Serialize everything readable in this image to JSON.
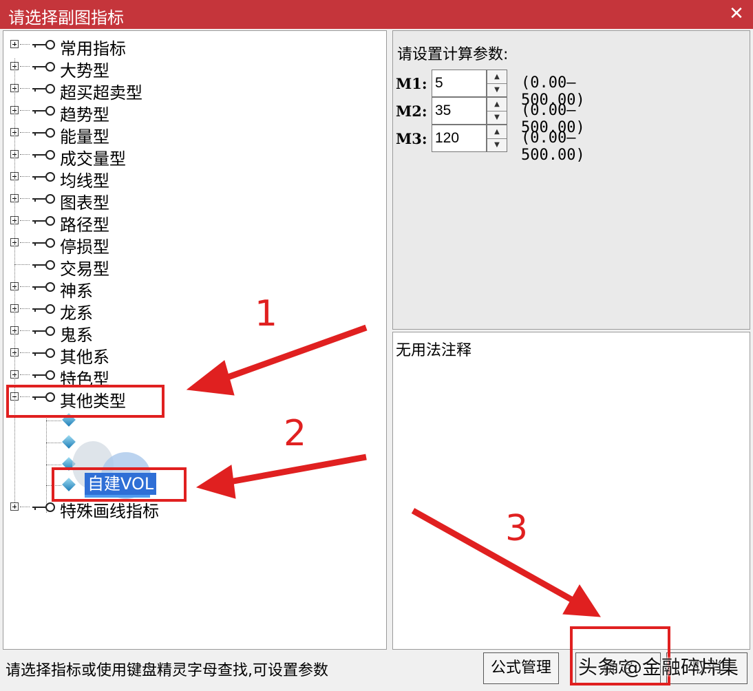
{
  "window": {
    "title": "请选择副图指标",
    "close_glyph": "✕"
  },
  "tree": {
    "categories": [
      {
        "label": "常用指标",
        "expander": "plus"
      },
      {
        "label": "大势型",
        "expander": "plus"
      },
      {
        "label": "超买超卖型",
        "expander": "plus"
      },
      {
        "label": "趋势型",
        "expander": "plus"
      },
      {
        "label": "能量型",
        "expander": "plus"
      },
      {
        "label": "成交量型",
        "expander": "plus"
      },
      {
        "label": "均线型",
        "expander": "plus"
      },
      {
        "label": "图表型",
        "expander": "plus"
      },
      {
        "label": "路径型",
        "expander": "plus"
      },
      {
        "label": "停损型",
        "expander": "plus"
      },
      {
        "label": "交易型",
        "expander": "none"
      },
      {
        "label": "神系",
        "expander": "plus"
      },
      {
        "label": "龙系",
        "expander": "plus"
      },
      {
        "label": "鬼系",
        "expander": "plus"
      },
      {
        "label": "其他系",
        "expander": "plus"
      },
      {
        "label": "特色型",
        "expander": "plus"
      },
      {
        "label": "其他类型",
        "expander": "minus"
      }
    ],
    "selected_leaf": "自建VOL",
    "last_category": "特殊画线指标"
  },
  "params": {
    "title": "请设置计算参数:",
    "rows": [
      {
        "label": "M1:",
        "value": "5",
        "range": "(0.00—500.00)"
      },
      {
        "label": "M2:",
        "value": "35",
        "range": "(0.00—500.00)"
      },
      {
        "label": "M3:",
        "value": "120",
        "range": "(0.00—500.00)"
      }
    ]
  },
  "note": "无用法注释",
  "status_text": "请选择指标或使用键盘精灵字母查找,可设置参数",
  "buttons": {
    "formula": "公式管理",
    "ok": "确定",
    "cancel": "取消"
  },
  "annotations": {
    "n1": "1",
    "n2": "2",
    "n3": "3",
    "accent": "#e02020"
  },
  "watermark": "头条 @金融碎片集"
}
